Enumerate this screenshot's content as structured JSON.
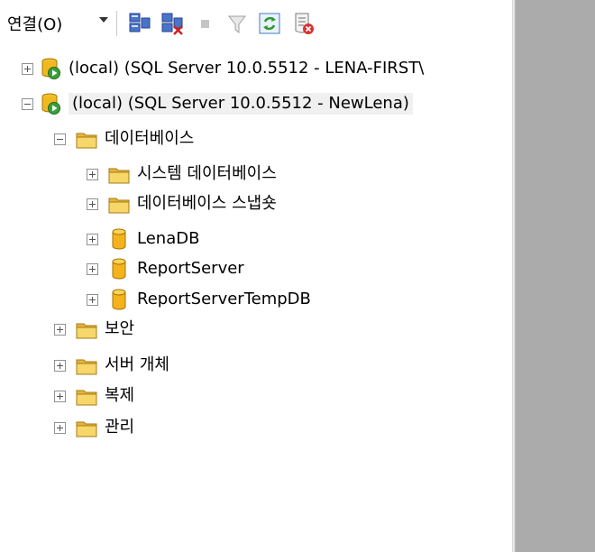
{
  "toolbar": {
    "connect_label": "연결(O)",
    "buttons": [
      "connect-object-explorer",
      "disconnect",
      "stop",
      "filter",
      "refresh",
      "summary"
    ]
  },
  "tree": {
    "server1": "(local) (SQL Server 10.0.5512 - LENA-FIRST\\",
    "server2": "(local) (SQL Server 10.0.5512 - NewLena)",
    "databases": "데이터베이스",
    "system_databases": "시스템 데이터베이스",
    "database_snapshots": "데이터베이스 스냅숏",
    "db1": "LenaDB",
    "db2": "ReportServer",
    "db3": "ReportServerTempDB",
    "security": "보안",
    "server_objects": "서버 개체",
    "replication": "복제",
    "management": "관리"
  },
  "colors": {
    "folder": "#f2cc4a",
    "db": "#f4b21c",
    "server_play": "#3aa03a",
    "gray_area": "#ababab"
  }
}
